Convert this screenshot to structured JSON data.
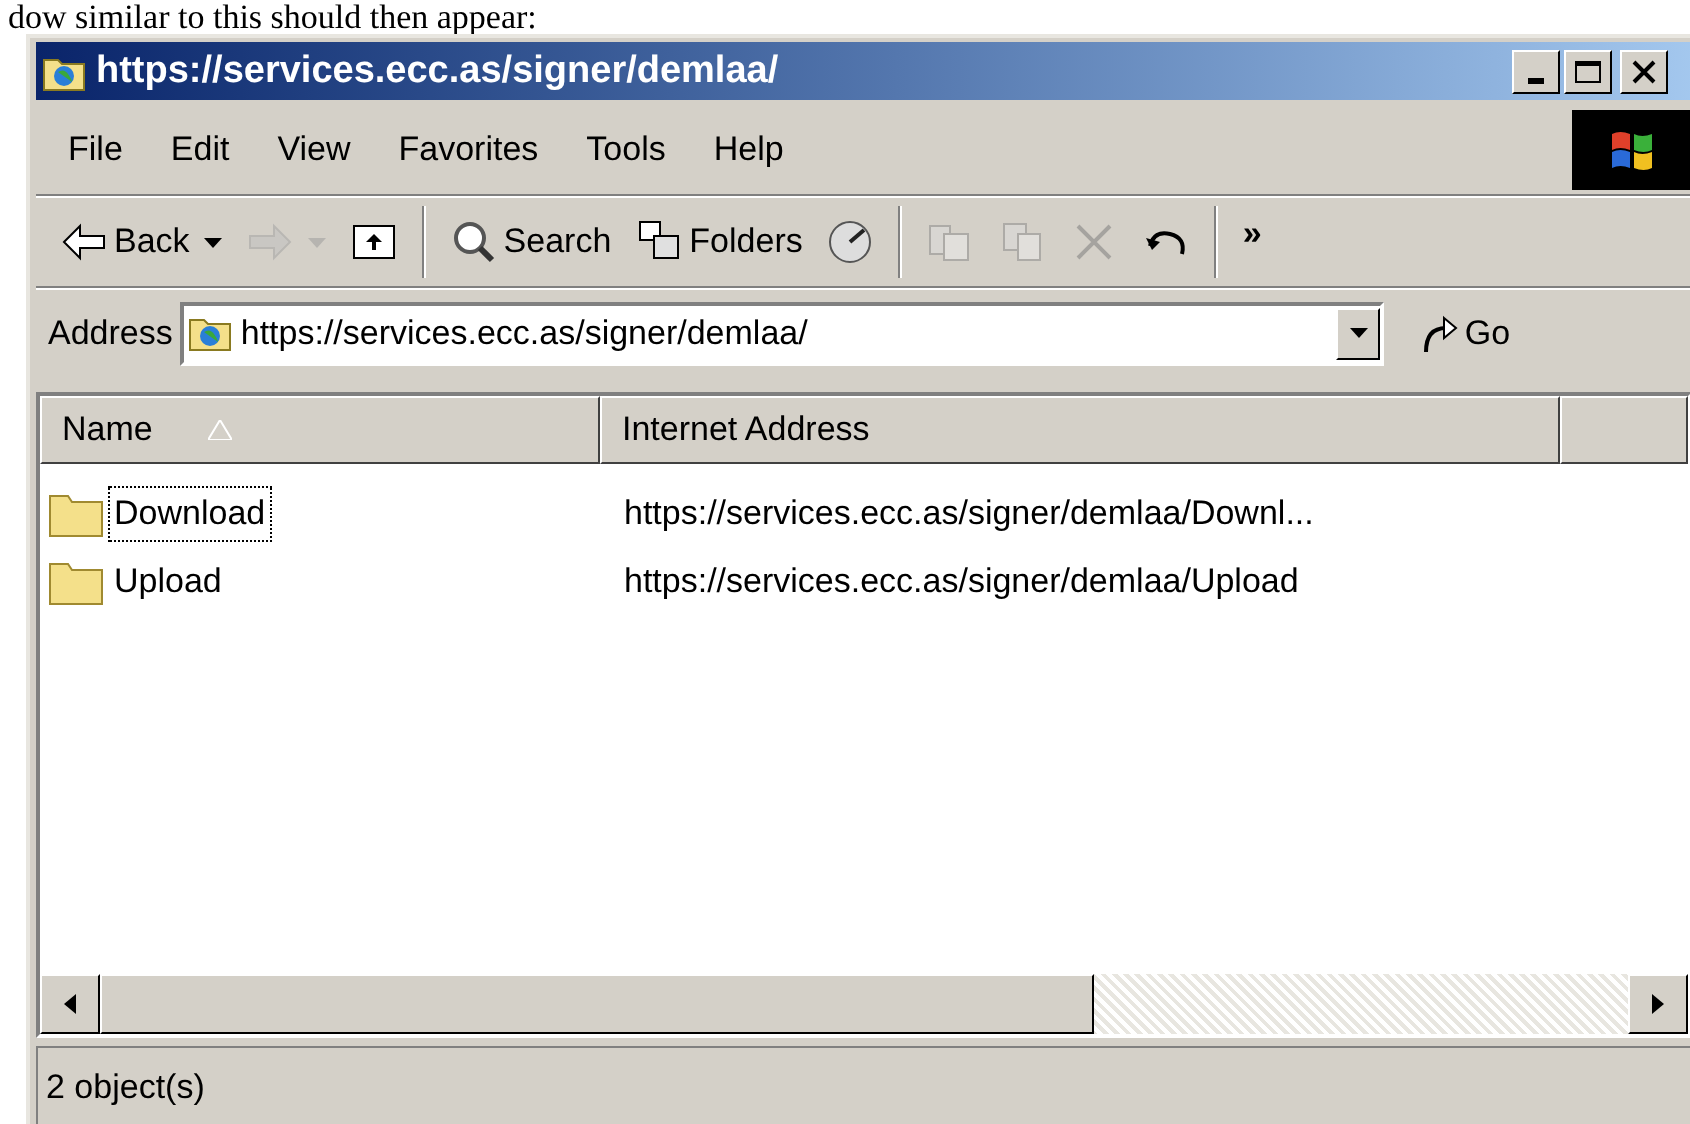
{
  "document_text": "dow similar to this should then appear:",
  "window": {
    "title": "https://services.ecc.as/signer/demlaa/"
  },
  "menu": [
    "File",
    "Edit",
    "View",
    "Favorites",
    "Tools",
    "Help"
  ],
  "toolbar": [
    {
      "kind": "back",
      "label": "Back",
      "disabled": false
    },
    {
      "kind": "forward",
      "disabled": true
    },
    {
      "kind": "up",
      "disabled": false
    },
    {
      "kind": "separator"
    },
    {
      "kind": "search",
      "label": "Search",
      "disabled": false
    },
    {
      "kind": "folders",
      "label": "Folders",
      "disabled": false
    },
    {
      "kind": "history",
      "disabled": false
    },
    {
      "kind": "separator"
    },
    {
      "kind": "move",
      "disabled": true
    },
    {
      "kind": "copy",
      "disabled": true
    },
    {
      "kind": "delete",
      "disabled": true
    },
    {
      "kind": "undo",
      "disabled": false
    },
    {
      "kind": "separator"
    },
    {
      "kind": "more",
      "label": "»",
      "disabled": false
    }
  ],
  "address_bar": {
    "label": "Address",
    "value": "https://services.ecc.as/signer/demlaa/",
    "go_label": "Go"
  },
  "table": {
    "columns": [
      "Name",
      "Internet Address"
    ],
    "rows": [
      {
        "name": "Download",
        "address": "https://services.ecc.as/signer/demlaa/Downl...",
        "selected": true
      },
      {
        "name": "Upload",
        "address": "https://services.ecc.as/signer/demlaa/Upload",
        "selected": false
      }
    ]
  },
  "status_bar": {
    "text": "2 object(s)"
  }
}
